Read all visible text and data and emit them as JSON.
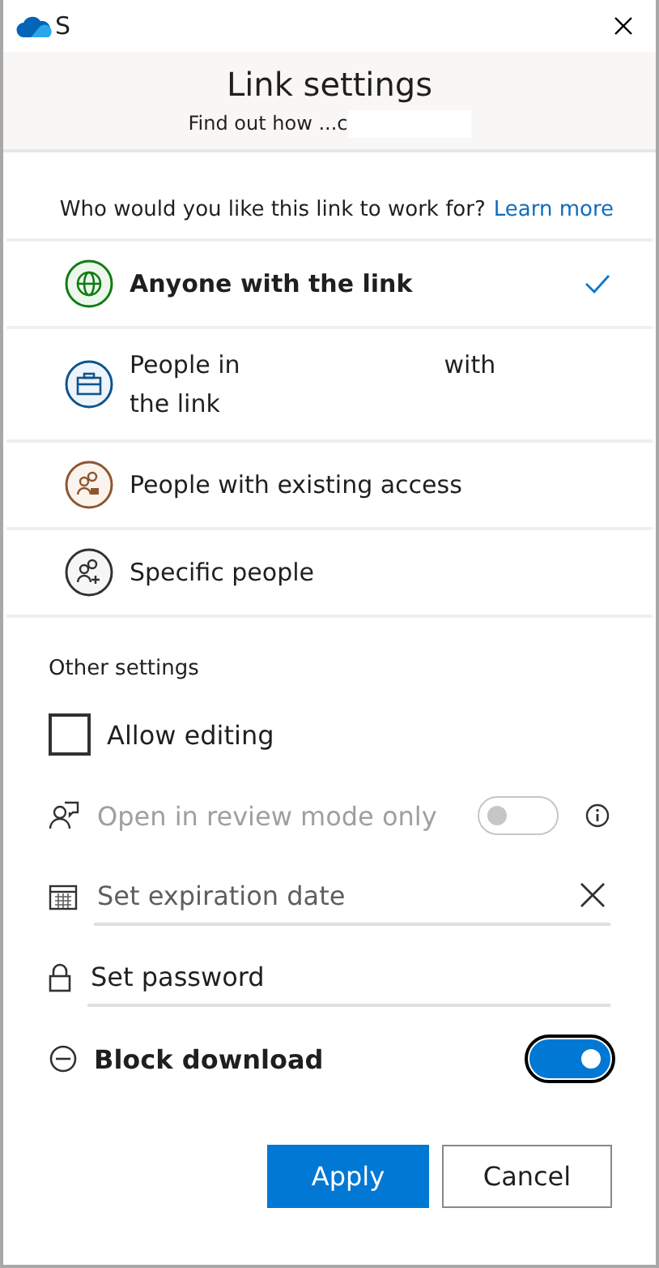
{
  "window": {
    "title": "S"
  },
  "header": {
    "title": "Link settings",
    "subtitle": "Find out how ...c"
  },
  "question": {
    "text": "Who would you like this link to work for?",
    "link": "Learn more"
  },
  "options": [
    {
      "kind": "globe",
      "label": "Anyone with the link",
      "selected": true
    },
    {
      "kind": "org",
      "label": "People in",
      "label_after": "with the link",
      "selected": false
    },
    {
      "kind": "existing",
      "label": "People with existing access",
      "selected": false
    },
    {
      "kind": "specific",
      "label": "Specific people",
      "selected": false
    }
  ],
  "other_settings": {
    "title": "Other settings",
    "settings": [
      {
        "kind": "checkbox",
        "label": "Allow editing",
        "checked": false
      },
      {
        "kind": "review",
        "label": "Open in review mode only",
        "on": false,
        "disabled": true
      },
      {
        "kind": "date",
        "placeholder": "Set expiration date"
      },
      {
        "kind": "password",
        "placeholder": "Set password"
      },
      {
        "kind": "block",
        "label": "Block download",
        "on": true
      }
    ]
  },
  "buttons": [
    {
      "kind": "primary",
      "label": "Apply"
    },
    {
      "kind": "secondary",
      "label": "Cancel"
    }
  ]
}
